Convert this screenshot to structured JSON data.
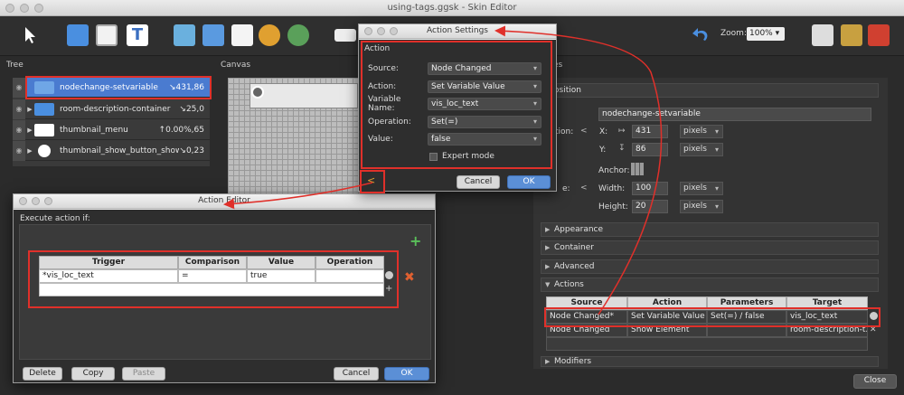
{
  "window": {
    "title": "using-tags.ggsk - Skin Editor"
  },
  "toolbar": {
    "zoom_label": "Zoom:",
    "zoom_value": "100%"
  },
  "panels": {
    "tree": "Tree",
    "canvas": "Canvas",
    "properties": "es"
  },
  "tree": {
    "items": [
      {
        "label": "nodechange-setvariable",
        "value": "↘431,86",
        "icon": "rectangle-icon",
        "selected": true
      },
      {
        "label": "room-description-container",
        "value": "↘25,0",
        "icon": "folder-icon"
      },
      {
        "label": "thumbnail_menu",
        "value": "↑0.00%,65",
        "icon": "monitor-icon"
      },
      {
        "label": "thumbnail_show_button_show",
        "value": "↘0,23",
        "icon": "dots-icon"
      }
    ]
  },
  "action_settings": {
    "title": "Action Settings",
    "group": "Action",
    "fields": [
      {
        "label": "Source:",
        "value": "Node Changed"
      },
      {
        "label": "Action:",
        "value": "Set Variable Value"
      },
      {
        "label": "Variable Name:",
        "value": "vis_loc_text"
      },
      {
        "label": "Operation:",
        "value": "Set(=)"
      },
      {
        "label": "Value:",
        "value": "false"
      }
    ],
    "expert_mode": "Expert mode",
    "cancel": "Cancel",
    "ok": "OK"
  },
  "action_editor": {
    "title": "Action Editor",
    "condition_label": "Execute action if:",
    "columns": [
      "Trigger",
      "Comparison",
      "Value",
      "Operation"
    ],
    "rows": [
      [
        "*vis_loc_text",
        "=",
        "true",
        ""
      ]
    ],
    "delete": "Delete",
    "copy": "Copy",
    "paste": "Paste",
    "cancel": "Cancel",
    "ok": "OK"
  },
  "properties": {
    "position_header": "osition",
    "name_value": "nodechange-setvariable",
    "position_label": "tion:",
    "x_label": "X:",
    "x_value": "431",
    "y_label": "Y:",
    "y_value": "86",
    "unit": "pixels",
    "anchor_label": "Anchor:",
    "size_label": "e:",
    "width_label": "Width:",
    "width_value": "100",
    "height_label": "Height:",
    "height_value": "20",
    "sections": [
      "Appearance",
      "Container",
      "Advanced",
      "Actions"
    ],
    "actions_columns": [
      "Source",
      "Action",
      "Parameters",
      "Target"
    ],
    "actions_rows": [
      [
        "Node Changed*",
        "Set Variable Value",
        "Set(=) / false",
        "vis_loc_text"
      ],
      [
        "Node Changed",
        "Show Element",
        "",
        "room-description-t..."
      ]
    ],
    "modifiers": "Modifiers"
  },
  "footer": {
    "close": "Close"
  },
  "colors": {
    "highlight": "#e0302a",
    "selection": "#4a7bd0"
  }
}
